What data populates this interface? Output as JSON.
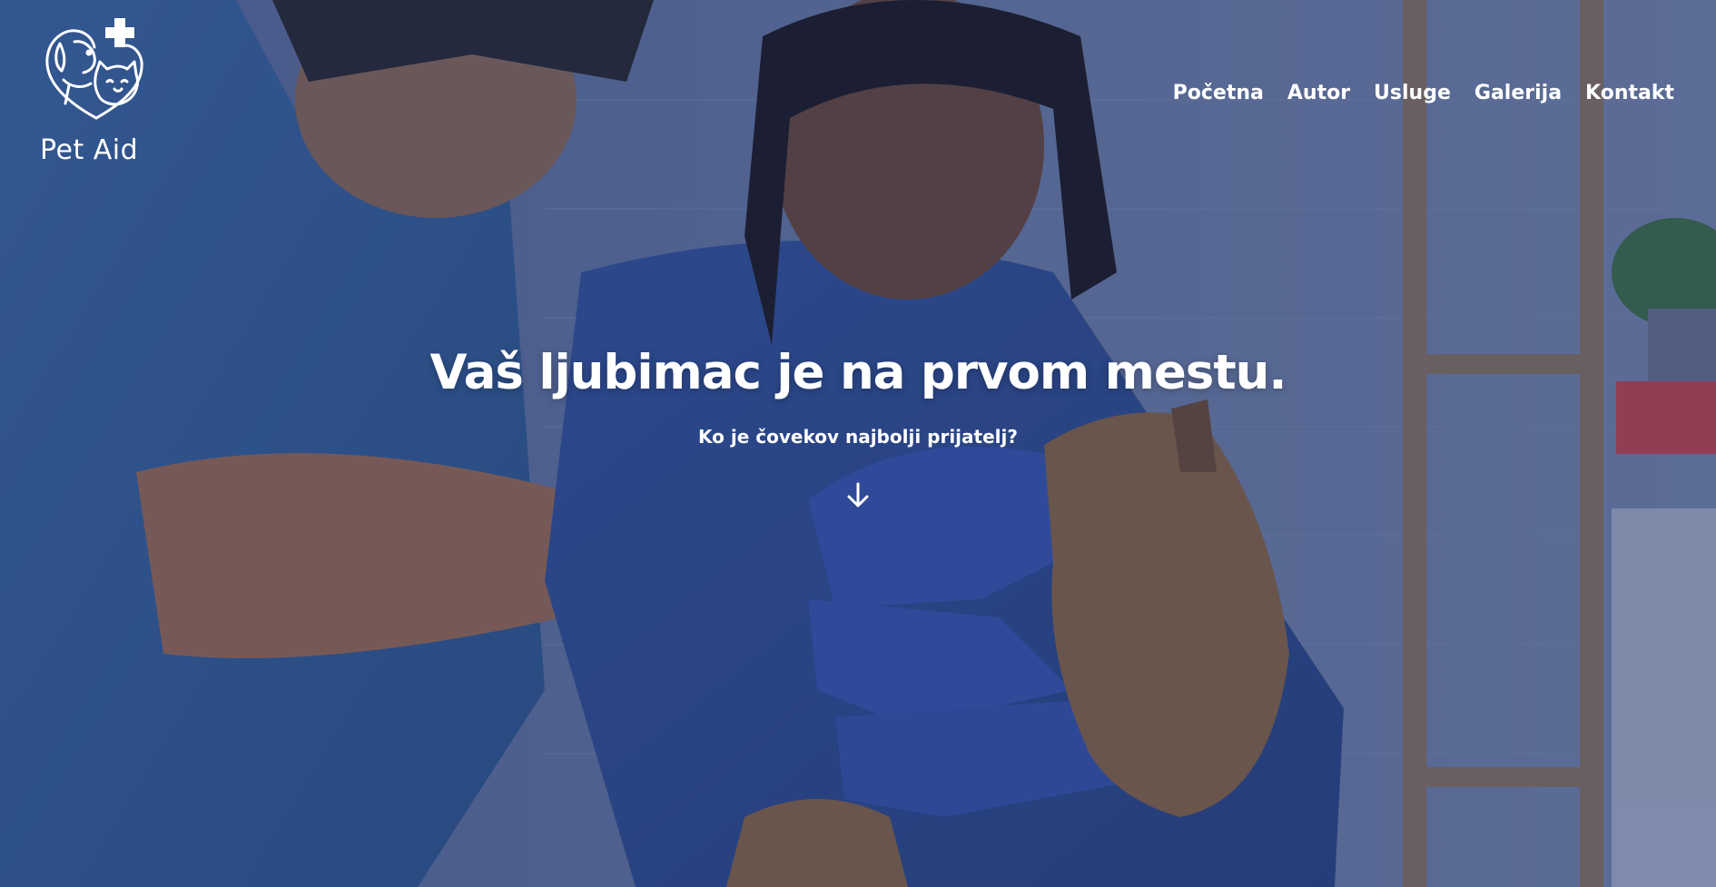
{
  "brand": {
    "name": "Pet Aid",
    "logo_icon": "pet-aid-logo-icon"
  },
  "nav": {
    "items": [
      {
        "label": "Početna"
      },
      {
        "label": "Autor"
      },
      {
        "label": "Usluge"
      },
      {
        "label": "Galerija"
      },
      {
        "label": "Kontakt"
      }
    ]
  },
  "hero": {
    "headline": "Vaš ljubimac je na prvom mestu.",
    "subline": "Ko je čovekov najbolji prijatelj?",
    "scroll_icon": "arrow-down-icon"
  },
  "colors": {
    "overlay": "#2a3f77",
    "text": "#ffffff"
  }
}
